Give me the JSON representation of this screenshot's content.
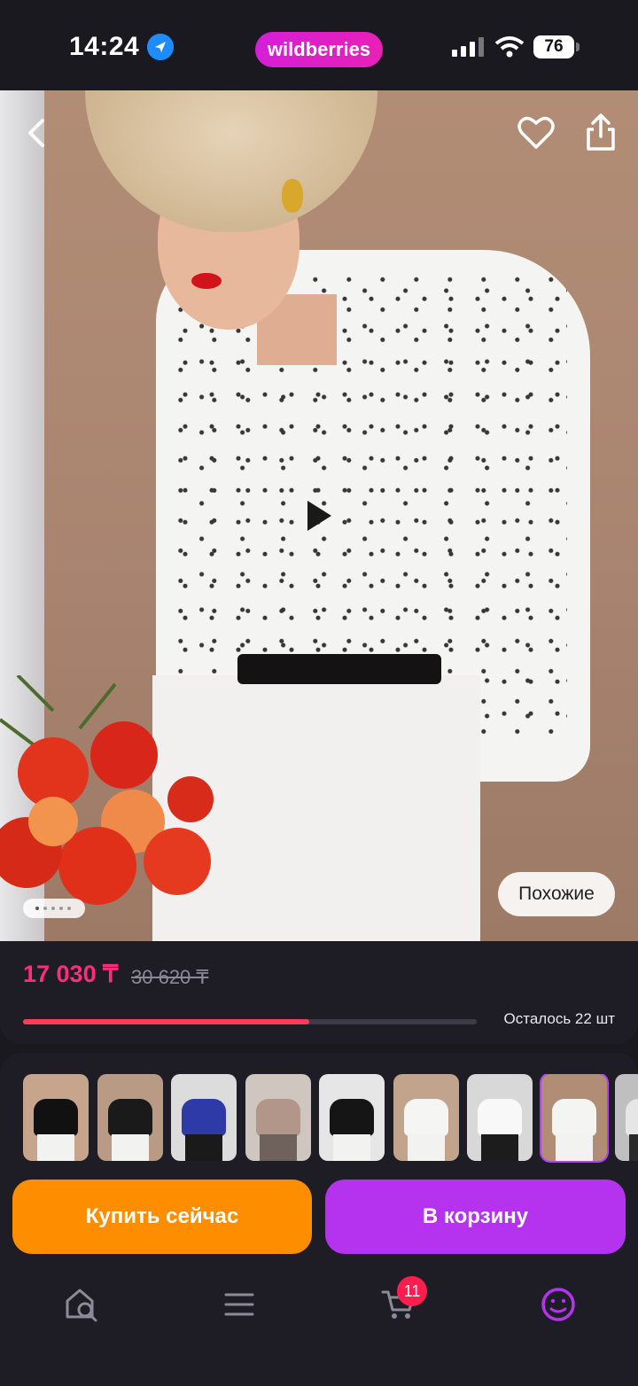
{
  "status_bar": {
    "time": "14:24",
    "brand": "wildberries",
    "battery": "76"
  },
  "product": {
    "price": "17 030 ₸",
    "old_price": "30 620 ₸",
    "stock_text": "Осталось 22 шт",
    "stock_fraction": 0.63,
    "similar_label": "Похожие",
    "gallery_pages": 5,
    "gallery_current": 1
  },
  "variants": [
    {
      "top": "#111111",
      "bottom": "#f2f2f0",
      "bg": "#c7a58c"
    },
    {
      "top": "#1a1a1a",
      "bottom": "#f2f2f0",
      "bg": "#b99a84"
    },
    {
      "top": "#2d3aa8",
      "bottom": "#1a1a1a",
      "bg": "#dcdcdc"
    },
    {
      "top": "#b3968a",
      "bottom": "#6f625c",
      "bg": "#cfc6c0"
    },
    {
      "top": "#151515",
      "bottom": "#f2f2f0",
      "bg": "#e6e6e6"
    },
    {
      "top": "#f5f5f3",
      "bottom": "#f2f2f0",
      "bg": "#c2a38b"
    },
    {
      "top": "#f8f8f8",
      "bottom": "#1c1c1c",
      "bg": "#d8d8d8"
    },
    {
      "top": "#f4f4f2",
      "bottom": "#f2f2f0",
      "bg": "#b28d75",
      "selected": true
    },
    {
      "top": "#e6e6e6",
      "bottom": "#2a2a2a",
      "bg": "#bfbfbf"
    }
  ],
  "actions": {
    "buy_now": "Купить сейчас",
    "to_cart": "В корзину"
  },
  "tabbar": {
    "cart_count": "11"
  },
  "colors": {
    "accent": "#b533ef",
    "buy": "#ff8d00",
    "price": "#ff2e7b",
    "progress": "#ff3b5c"
  }
}
